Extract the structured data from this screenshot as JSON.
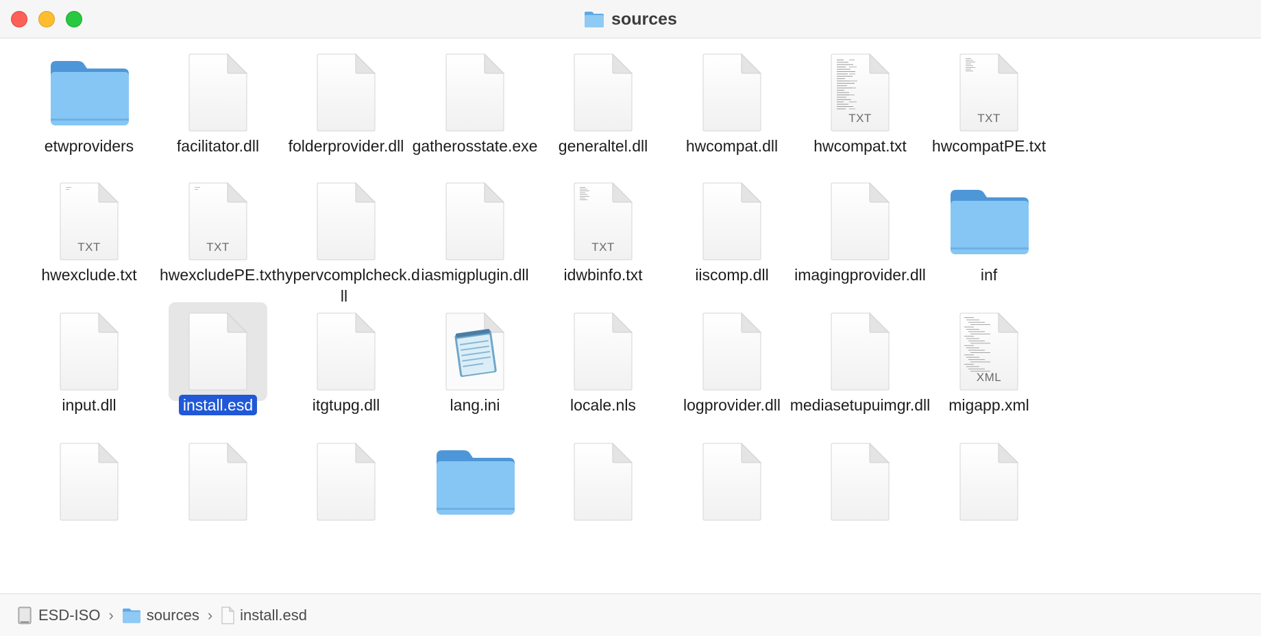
{
  "window": {
    "title": "sources",
    "title_icon": "folder-icon"
  },
  "colors": {
    "folder": "#7cc0f2",
    "selection": "#2058d7",
    "selected_tile": "#e6e6e6"
  },
  "items": [
    {
      "label": "etwproviders",
      "kind": "folder"
    },
    {
      "label": "facilitator.dll",
      "kind": "file"
    },
    {
      "label": "folderprovider.dll",
      "kind": "file"
    },
    {
      "label": "gatherosstate.exe",
      "kind": "file"
    },
    {
      "label": "generaltel.dll",
      "kind": "file"
    },
    {
      "label": "hwcompat.dll",
      "kind": "file"
    },
    {
      "label": "hwcompat.txt",
      "kind": "txt-dense",
      "ext": "TXT"
    },
    {
      "label": "hwcompatPE.txt",
      "kind": "txt-sparse",
      "ext": "TXT"
    },
    {
      "label": "hwexclude.txt",
      "kind": "txt-blank",
      "ext": "TXT"
    },
    {
      "label": "hwexcludePE.txt",
      "kind": "txt-blank",
      "ext": "TXT"
    },
    {
      "label": "hypervcomplcheck.dll",
      "kind": "file"
    },
    {
      "label": "iasmigplugin.dll",
      "kind": "file"
    },
    {
      "label": "idwbinfo.txt",
      "kind": "txt-sparse",
      "ext": "TXT"
    },
    {
      "label": "iiscomp.dll",
      "kind": "file"
    },
    {
      "label": "imagingprovider.dll",
      "kind": "file"
    },
    {
      "label": "inf",
      "kind": "folder"
    },
    {
      "label": "input.dll",
      "kind": "file"
    },
    {
      "label": "install.esd",
      "kind": "file",
      "selected": true
    },
    {
      "label": "itgtupg.dll",
      "kind": "file"
    },
    {
      "label": "lang.ini",
      "kind": "ini"
    },
    {
      "label": "locale.nls",
      "kind": "file"
    },
    {
      "label": "logprovider.dll",
      "kind": "file"
    },
    {
      "label": "mediasetupuimgr.dll",
      "kind": "file"
    },
    {
      "label": "migapp.xml",
      "kind": "xml",
      "ext": "XML"
    },
    {
      "label": "",
      "kind": "file"
    },
    {
      "label": "",
      "kind": "file"
    },
    {
      "label": "",
      "kind": "file"
    },
    {
      "label": "",
      "kind": "folder"
    },
    {
      "label": "",
      "kind": "file"
    },
    {
      "label": "",
      "kind": "file"
    },
    {
      "label": "",
      "kind": "file"
    },
    {
      "label": "",
      "kind": "file"
    }
  ],
  "pathbar": {
    "crumbs": [
      {
        "label": "ESD-ISO",
        "icon": "drive-icon"
      },
      {
        "label": "sources",
        "icon": "folder-icon"
      },
      {
        "label": "install.esd",
        "icon": "document-icon"
      }
    ],
    "separator": "›"
  }
}
